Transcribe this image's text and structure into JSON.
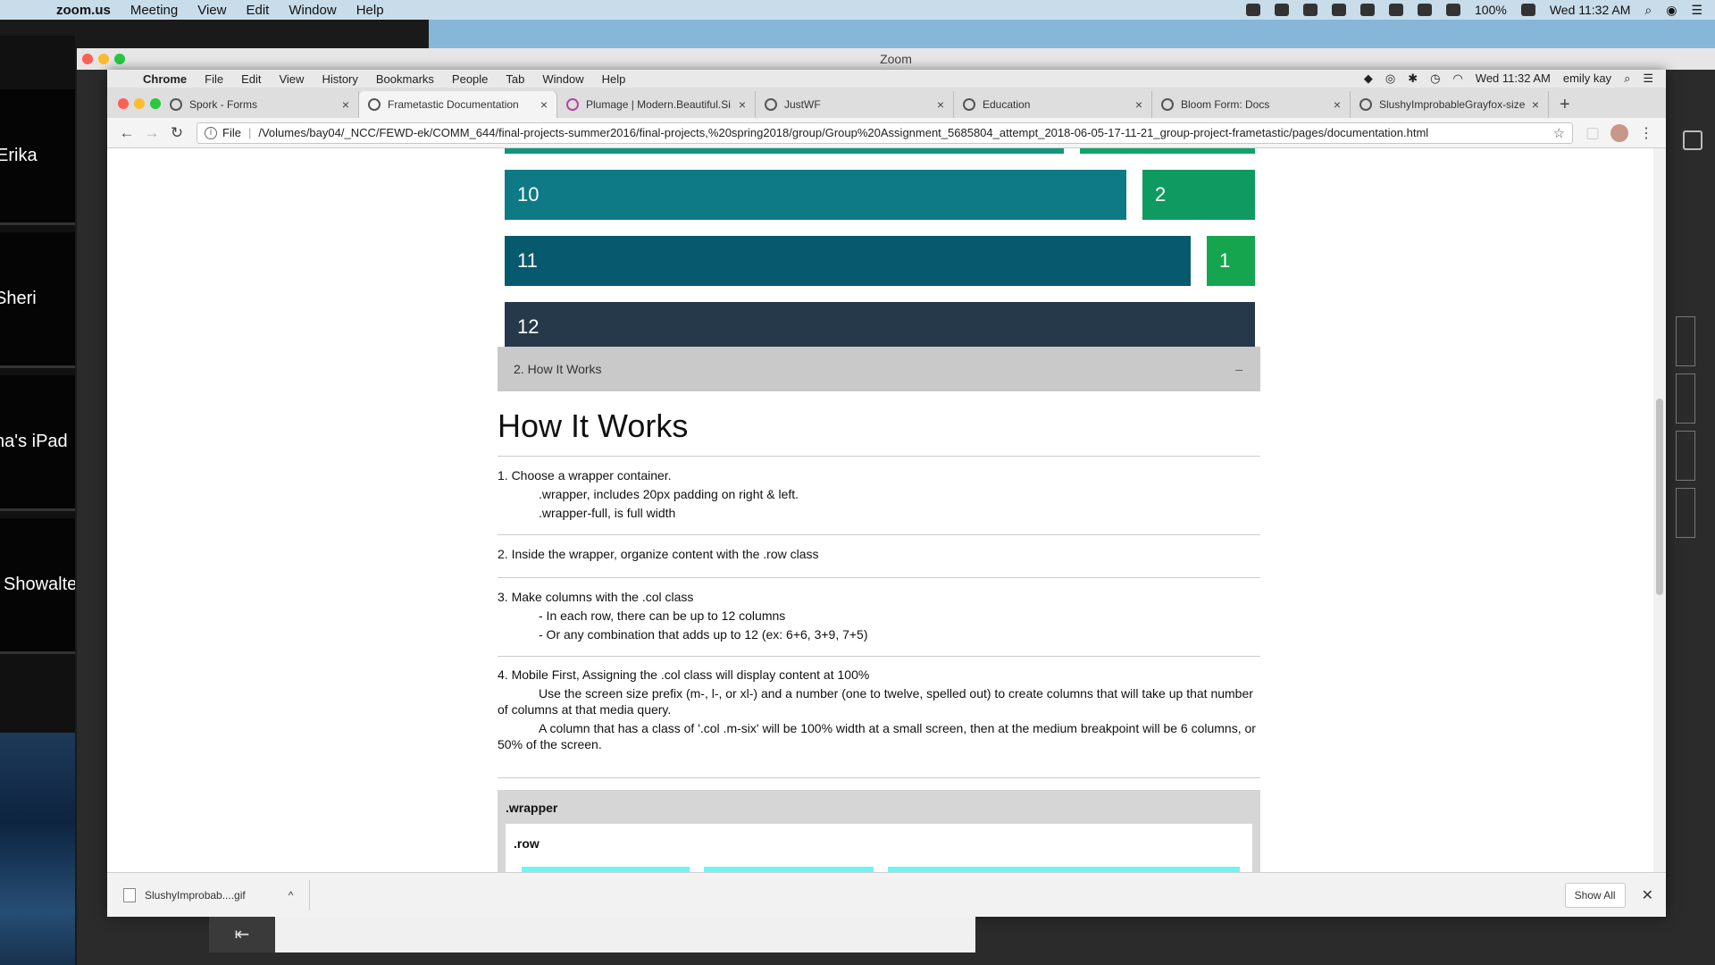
{
  "mac_menu": {
    "apple": "",
    "items": [
      "zoom.us",
      "Meeting",
      "View",
      "Edit",
      "Window",
      "Help"
    ],
    "battery": "100%",
    "clock": "Wed 11:32 AM"
  },
  "zoom": {
    "title": "Zoom",
    "participants": [
      "Erika",
      "Sheri",
      "na's iPad",
      "Showalte"
    ]
  },
  "chrome_menu": {
    "items": [
      "Chrome",
      "File",
      "Edit",
      "View",
      "History",
      "Bookmarks",
      "People",
      "Tab",
      "Window",
      "Help"
    ],
    "clock": "Wed 11:32 AM",
    "user": "emily kay"
  },
  "tabs": [
    {
      "title": "Spork - Forms"
    },
    {
      "title": "Frametastic Documentation"
    },
    {
      "title": "Plumage | Modern.Beautiful.Si"
    },
    {
      "title": "JustWF"
    },
    {
      "title": "Education"
    },
    {
      "title": "Bloom Form: Docs"
    },
    {
      "title": "SlushyImprobableGrayfox-size"
    }
  ],
  "address": {
    "scheme_label": "File",
    "url": "/Volumes/bay04/_NCC/FEWD-ek/COMM_644/final-projects-summer2016/final-projects,%20spring2018/group/Group%20Assignment_5685804_attempt_2018-06-05-17-11-21_group-project-frametastic/pages/documentation.html"
  },
  "grid_demo": [
    {
      "left": "10",
      "right": "2"
    },
    {
      "left": "11",
      "right": "1"
    },
    {
      "left": "12"
    }
  ],
  "colors": {
    "row10_left": "#0e7a86",
    "row10_right": "#0f9a62",
    "row11_left": "#07596e",
    "row11_right": "#15a54e",
    "row12": "#26394a",
    "cyan_col": "#6ef5f2"
  },
  "accordion": {
    "label": "2. How It Works",
    "toggle": "–"
  },
  "doc": {
    "heading": "How It Works",
    "step1": {
      "title": "1. Choose a wrapper container.",
      "lines": [
        ".wrapper, includes 20px padding on right & left.",
        ".wrapper-full, is full width"
      ]
    },
    "step2": {
      "title": "2. Inside the wrapper, organize content with the .row class"
    },
    "step3": {
      "title": "3. Make columns with the .col class",
      "lines": [
        "- In each row, there can be up to 12 columns",
        "- Or any combination that adds up to 12 (ex: 6+6, 3+9, 7+5)"
      ]
    },
    "step4": {
      "title": "4. Mobile First, Assigning the .col class will display content at 100%",
      "p1": "Use the screen size prefix (m-, l-, or xl-) and a number (one to twelve, spelled out) to create columns that will take up that number of columns at that media query.",
      "p2": "A column that has a class of '.col .m-six' will be 100% width at a small screen, then at the medium breakpoint will be 6 columns, or 50% of the screen."
    },
    "demo_wrapper": ".wrapper",
    "demo_row": ".row"
  },
  "downloads": {
    "file": "SlushyImprobab....gif",
    "chevron": "^",
    "show_all": "Show All",
    "close": "✕"
  }
}
